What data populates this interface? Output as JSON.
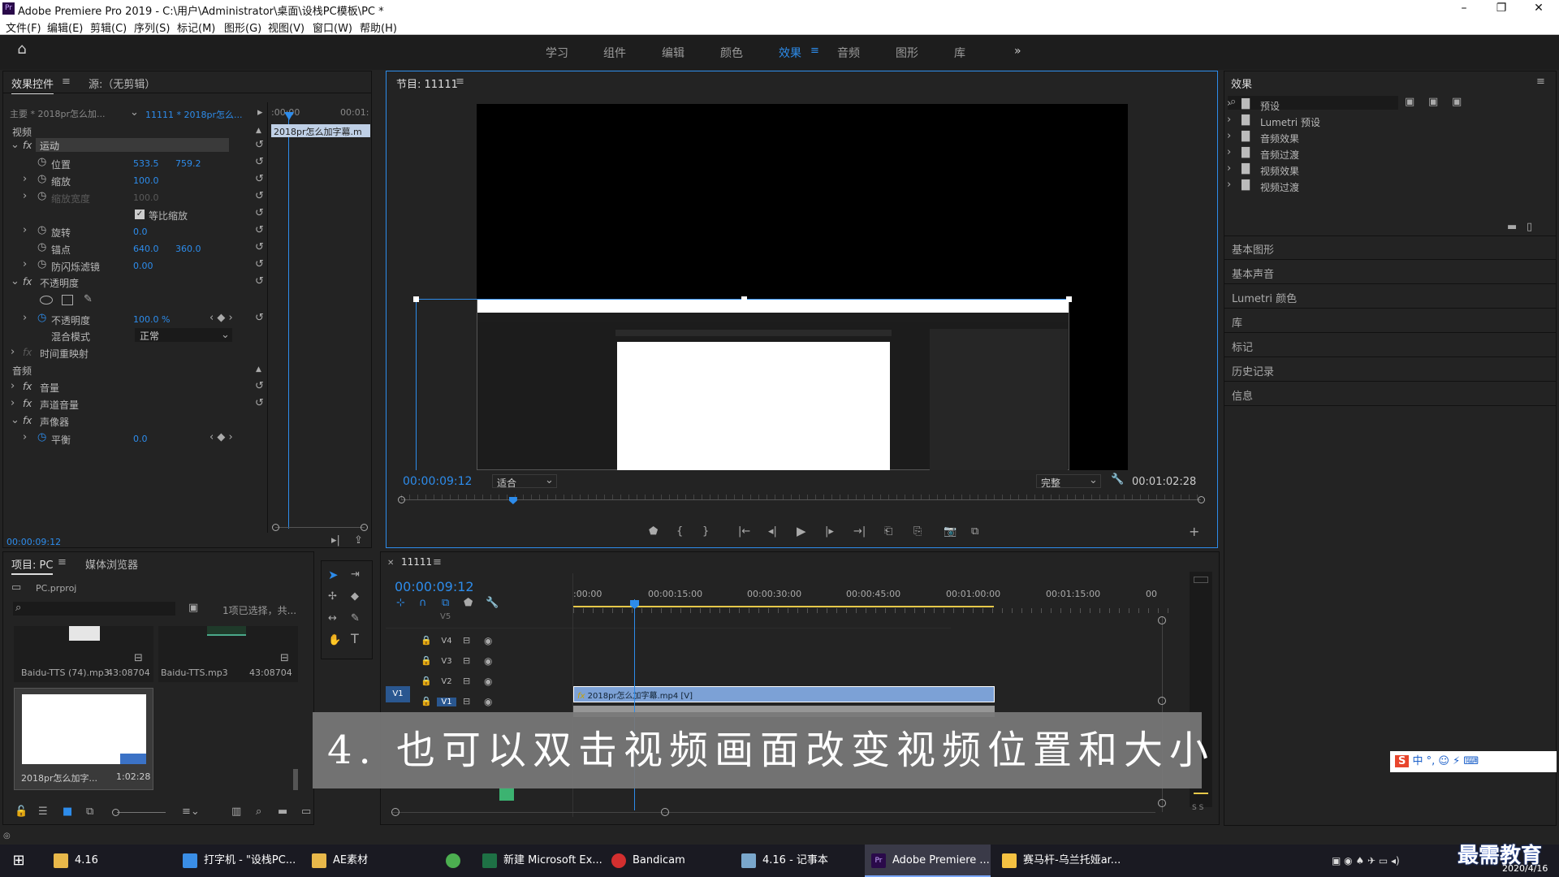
{
  "title_bar": {
    "app_icon": "Pr",
    "title": "Adobe Premiere Pro 2019 - C:\\用户\\Administrator\\桌面\\设栈PC模板\\PC *"
  },
  "menu": [
    "文件(F)",
    "编辑(E)",
    "剪辑(C)",
    "序列(S)",
    "标记(M)",
    "图形(G)",
    "视图(V)",
    "窗口(W)",
    "帮助(H)"
  ],
  "workspaces": [
    "学习",
    "组件",
    "编辑",
    "颜色",
    "效果",
    "音频",
    "图形",
    "库"
  ],
  "active_workspace": "效果",
  "effect_controls": {
    "tab": "效果控件",
    "source_tab": "源:（无剪辑）",
    "master": "主要 * 2018pr怎么加...",
    "sequence": "11111 * 2018pr怎么...",
    "ruler_start": ":00:00",
    "ruler_end": "00:01:",
    "clip_label": "2018pr怎么加字幕.m",
    "section_video": "视频",
    "motion": "运动",
    "position_label": "位置",
    "position_x": "533.5",
    "position_y": "759.2",
    "scale_label": "缩放",
    "scale": "100.0",
    "scale_width_label": "缩放宽度",
    "scale_width": "100.0",
    "uniform_scale": "等比缩放",
    "rotation_label": "旋转",
    "rotation": "0.0",
    "anchor_label": "锚点",
    "anchor_x": "640.0",
    "anchor_y": "360.0",
    "flicker_label": "防闪烁滤镜",
    "flicker": "0.00",
    "opacity": "不透明度",
    "opacity_label": "不透明度",
    "opacity_value": "100.0 %",
    "blend_label": "混合模式",
    "blend_value": "正常",
    "time_remap": "时间重映射",
    "section_audio": "音频",
    "volume": "音量",
    "channel_volume": "声道音量",
    "panner": "声像器",
    "balance_label": "平衡",
    "balance": "0.0",
    "timecode": "00:00:09:12"
  },
  "program_monitor": {
    "tab": "节目: 11111",
    "timecode": "00:00:09:12",
    "fit": "适合",
    "quality": "完整",
    "duration": "00:01:02:28",
    "playhead_fraction": 0.14
  },
  "effects_panel": {
    "title": "效果",
    "tree": [
      "预设",
      "Lumetri 预设",
      "音频效果",
      "音频过渡",
      "视频效果",
      "视频过渡"
    ],
    "sections": [
      "基本图形",
      "基本声音",
      "Lumetri 颜色",
      "库",
      "标记",
      "历史记录",
      "信息"
    ]
  },
  "project": {
    "tab": "项目: PC",
    "media_browser": "媒体浏览器",
    "file": "PC.prproj",
    "selection": "1项已选择，共...",
    "items": [
      {
        "name": "Baidu-TTS (74).mp3",
        "dur": "43:08704"
      },
      {
        "name": "Baidu-TTS.mp3",
        "dur": "43:08704"
      },
      {
        "name": "2018pr怎么加字...",
        "dur": "1:02:28"
      }
    ]
  },
  "timeline": {
    "tab": "11111",
    "timecode": "00:00:09:12",
    "ruler": [
      ":00:00",
      "00:00:15:00",
      "00:00:30:00",
      "00:00:45:00",
      "00:01:00:00",
      "00:01:15:00",
      "00"
    ],
    "tracks": [
      "V4",
      "V3",
      "V2",
      "V1"
    ],
    "v5": "V5",
    "clip": "2018pr怎么加字幕.mp4 [V]",
    "meter": "S  S"
  },
  "banner": "4. 也可以双击视频画面改变视频位置和大小",
  "taskbar": {
    "items": [
      "4.16",
      "打字机 - \"设栈PC...",
      "AE素材",
      "新建 Microsoft Ex...",
      "Bandicam",
      "4.16 - 记事本",
      "Adobe Premiere ...",
      "赛马杆-乌兰托娅ar..."
    ],
    "date": "2020/4/16",
    "watermark": "最需教育"
  },
  "ime": "中 °, ☺ ⚡ ⌨"
}
